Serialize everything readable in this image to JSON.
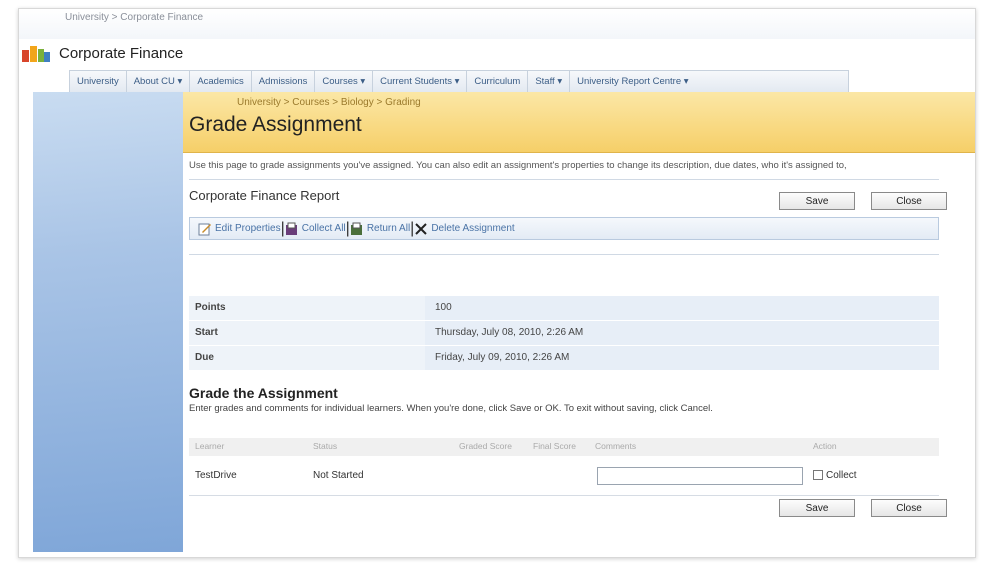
{
  "header": {
    "top_breadcrumb": "University > Corporate Finance",
    "site_title": "Corporate Finance"
  },
  "nav": {
    "items": [
      {
        "label": "University"
      },
      {
        "label": "About CU ▾"
      },
      {
        "label": "Academics"
      },
      {
        "label": "Admissions"
      },
      {
        "label": "Courses ▾"
      },
      {
        "label": "Current Students ▾"
      },
      {
        "label": "Curriculum"
      },
      {
        "label": "Staff ▾"
      },
      {
        "label": "University Report Centre ▾"
      }
    ]
  },
  "page": {
    "breadcrumb": "University > Courses > Biology > Grading",
    "title": "Grade Assignment",
    "description": "Use this page to grade assignments you've assigned. You can also edit an assignment's properties to change its description, due dates, who it's assigned to,"
  },
  "assignment": {
    "name": "Corporate Finance Report",
    "save_label": "Save",
    "close_label": "Close"
  },
  "toolbar": {
    "edit_properties": "Edit Properties",
    "collect_all": "Collect All",
    "return_all": "Return All",
    "delete_assignment": "Delete Assignment"
  },
  "properties": [
    {
      "label": "Points",
      "value": "100"
    },
    {
      "label": "Start",
      "value": "Thursday, July 08, 2010, 2:26 AM"
    },
    {
      "label": "Due",
      "value": "Friday, July 09, 2010, 2:26 AM"
    }
  ],
  "grading": {
    "title": "Grade the Assignment",
    "instructions": "Enter grades and comments for individual learners. When you're done, click Save or OK. To exit without saving, click Cancel.",
    "columns": {
      "learner": "Learner",
      "status": "Status",
      "graded_score": "Graded Score",
      "final_score": "Final Score",
      "comments": "Comments",
      "action": "Action"
    },
    "rows": [
      {
        "learner": "TestDrive",
        "status": "Not Started",
        "action": "Collect"
      }
    ],
    "save_label": "Save",
    "close_label": "Close"
  },
  "colors": {
    "accent_band": "#f6cf68",
    "left_nav": "#7fa6d8",
    "link": "#4a73a6"
  }
}
